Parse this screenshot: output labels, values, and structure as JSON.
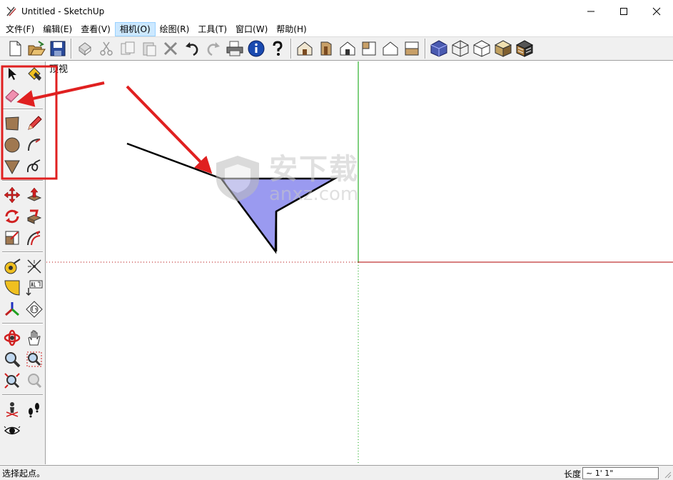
{
  "window": {
    "title": "Untitled - SketchUp",
    "controls": [
      "minimize",
      "maximize",
      "close"
    ]
  },
  "menu": [
    {
      "label": "文件(F)",
      "active": false
    },
    {
      "label": "编辑(E)",
      "active": false
    },
    {
      "label": "查看(V)",
      "active": false
    },
    {
      "label": "相机(O)",
      "active": true
    },
    {
      "label": "绘图(R)",
      "active": false
    },
    {
      "label": "工具(T)",
      "active": false
    },
    {
      "label": "窗口(W)",
      "active": false
    },
    {
      "label": "帮助(H)",
      "active": false
    }
  ],
  "toolbar": {
    "groups": [
      [
        "new-icon",
        "open-icon",
        "save-icon"
      ],
      [
        "make-component-icon",
        "cut-icon",
        "copy-icon",
        "paste-icon",
        "erase-icon",
        "undo-icon",
        "redo-icon",
        "print-icon",
        "model-info-icon",
        "help-icon"
      ],
      [
        "iso-view-icon",
        "front-view-icon",
        "top-view-icon",
        "right-view-icon",
        "back-view-icon",
        "left-view-icon"
      ],
      [
        "xray-icon",
        "wireframe-icon",
        "hidden-line-icon",
        "shaded-icon",
        "textured-icon"
      ]
    ]
  },
  "palette": {
    "groups": [
      [
        "select-icon",
        "paint-bucket-icon",
        "eraser-icon"
      ],
      [
        "rectangle-icon",
        "pencil-icon",
        "circle-icon",
        "arc-icon",
        "polygon-icon",
        "freehand-icon"
      ],
      [
        "move-icon",
        "push-pull-icon",
        "rotate-icon",
        "follow-me-icon",
        "scale-icon",
        "offset-icon"
      ],
      [
        "tape-measure-icon",
        "dimension-icon",
        "protractor-icon",
        "text-icon",
        "axes-icon",
        "3d-text-icon"
      ],
      [
        "orbit-icon",
        "pan-icon",
        "zoom-icon",
        "zoom-window-icon",
        "zoom-extents-icon",
        "previous-view-icon"
      ],
      [
        "position-camera-icon",
        "walk-icon",
        "look-around-icon"
      ]
    ]
  },
  "canvas": {
    "view_label": "顶视",
    "colors": {
      "face": "#9a9af0",
      "edge": "#000000",
      "axis_green": "#00a000",
      "axis_red": "#b00000",
      "annotation": "#e02020"
    }
  },
  "watermark": {
    "cn": "安下载",
    "en": "anxz.com"
  },
  "status": {
    "message": "选择起点。",
    "vcb_label": "长度",
    "vcb_value": "~ 1' 1\""
  }
}
